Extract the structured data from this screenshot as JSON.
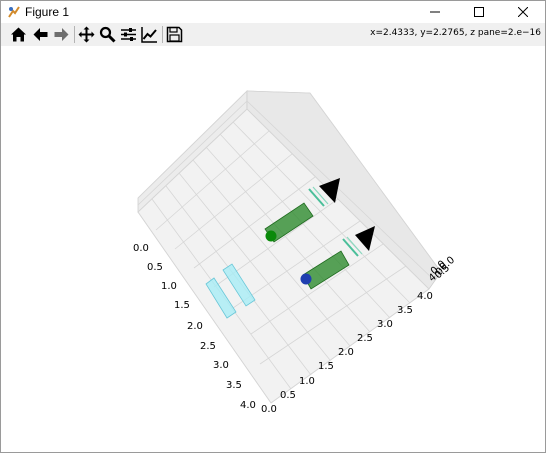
{
  "window": {
    "title": "Figure 1",
    "icon": "matplotlib-figure-icon",
    "controls": [
      "minimize-icon",
      "maximize-icon",
      "close-icon"
    ]
  },
  "toolbar": {
    "buttons": [
      {
        "name": "home-button",
        "icon": "home-icon"
      },
      {
        "name": "back-button",
        "icon": "arrow-left-icon"
      },
      {
        "name": "forward-button",
        "icon": "arrow-right-icon"
      },
      {
        "name": "pan-button",
        "icon": "move-icon"
      },
      {
        "name": "zoom-button",
        "icon": "magnifier-icon"
      },
      {
        "name": "configure-subplots-button",
        "icon": "sliders-icon"
      },
      {
        "name": "edit-axis-button",
        "icon": "line-chart-icon"
      },
      {
        "name": "save-button",
        "icon": "floppy-disk-icon"
      }
    ],
    "coordinates": "x=2.4333, y=2.2765, z pane=2.e−16"
  },
  "plot": {
    "axis_left_ticks": [
      "0.0",
      "0.5",
      "1.0",
      "1.5",
      "2.0",
      "2.5",
      "3.0",
      "3.5",
      "4.0"
    ],
    "axis_bottom_ticks": [
      "0.0",
      "0.5",
      "1.0",
      "1.5",
      "2.0",
      "2.5",
      "3.0",
      "3.5",
      "4.0"
    ],
    "axis_right_ticks": [
      "4.0",
      "0.0",
      "0.5",
      "0.0"
    ],
    "colors": {
      "pane": "#f2f2f2",
      "grid": "#d0d0d0",
      "cylinder": "#2e8b2e",
      "cyan_box": "#a8ecf5",
      "marker_green": "#0a8a0a",
      "marker_blue": "#1f3fb0",
      "cone": "#000000"
    }
  }
}
